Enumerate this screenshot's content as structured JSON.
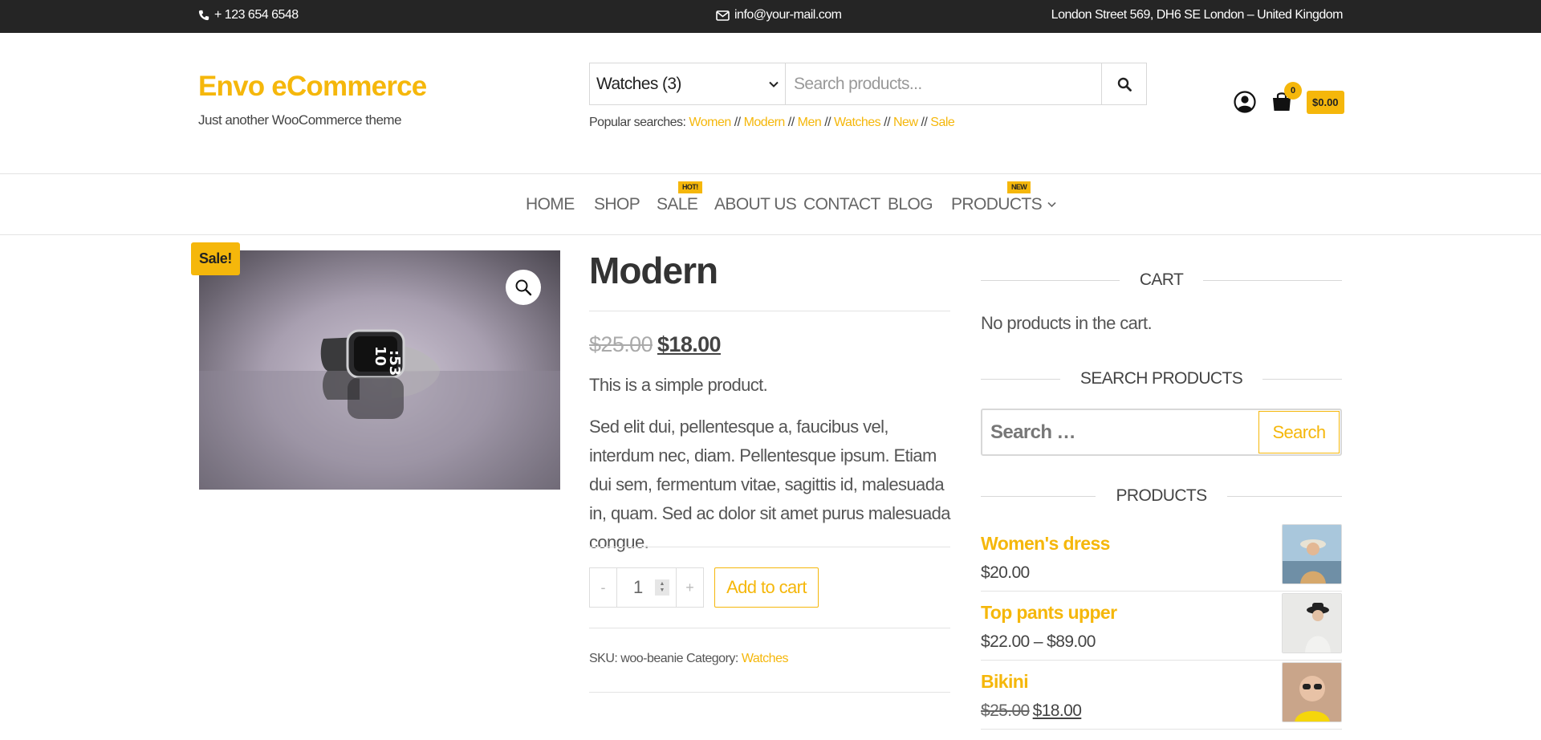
{
  "topbar": {
    "phone": "+ 123 654 6548",
    "email": "info@your-mail.com",
    "address": "London Street 569, DH6 SE London – United Kingdom"
  },
  "header": {
    "site_title": "Envo eCommerce",
    "site_description": "Just another WooCommerce theme",
    "category_select": "Watches  (3)",
    "search_placeholder": "Search products...",
    "popular_label": "Popular searches:",
    "popular_links": [
      "Women",
      "Modern",
      "Men",
      "Watches",
      "New",
      "Sale"
    ],
    "popular_separator": "//",
    "cart_count": "0",
    "cart_total": "$0.00"
  },
  "nav": {
    "items": [
      {
        "label": "HOME"
      },
      {
        "label": "SHOP"
      },
      {
        "label": "SALE",
        "badge": "HOT!"
      },
      {
        "label": "ABOUT US"
      },
      {
        "label": "CONTACT"
      },
      {
        "label": "BLOG"
      },
      {
        "label": "PRODUCTS",
        "badge": "NEW"
      }
    ]
  },
  "product": {
    "sale_flag": "Sale!",
    "title": "Modern",
    "price_old": "$25.00",
    "price_new": "$18.00",
    "short_description": "This is a simple product.",
    "description": "Sed elit dui, pellentesque a, faucibus vel, interdum nec, diam. Pellentesque ipsum. Etiam dui sem, fermentum vitae, sagittis id, malesuada in, quam. Sed ac dolor sit amet purus malesuada congue.",
    "qty_minus": "-",
    "qty_value": "1",
    "qty_plus": "+",
    "add_to_cart": "Add to cart",
    "sku_label": "SKU:",
    "sku_value": "woo-beanie",
    "category_label": "Category:",
    "category_value": "Watches",
    "watch_time_hour": "10",
    "watch_time_min": ":53"
  },
  "sidebar": {
    "cart_title": "CART",
    "cart_empty": "No products in the cart.",
    "search_title": "SEARCH PRODUCTS",
    "search_placeholder": "Search …",
    "search_button": "Search",
    "products_title": "PRODUCTS",
    "products": [
      {
        "name": "Women's dress",
        "price": "$20.00"
      },
      {
        "name": "Top pants upper",
        "price": "$22.00 – $89.00"
      },
      {
        "name": "Bikini",
        "price_old": "$25.00",
        "price_new": "$18.00"
      }
    ]
  },
  "colors": {
    "accent": "#f5b70b",
    "topbar_bg": "#252525"
  }
}
